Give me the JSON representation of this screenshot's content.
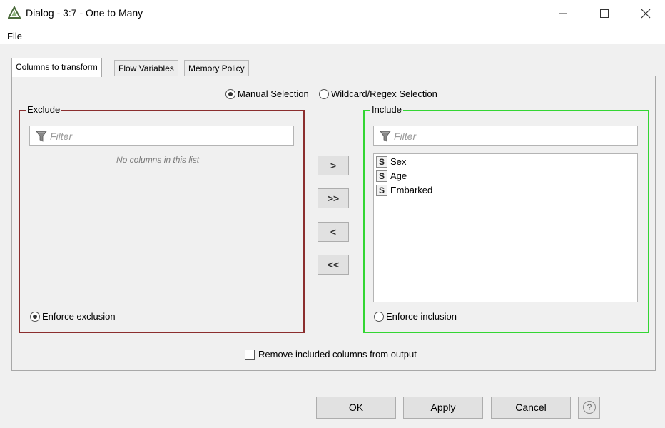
{
  "window": {
    "title": "Dialog - 3:7 - One to Many",
    "app_icon": "knime-triangle-icon",
    "controls": [
      "minimize-icon",
      "maximize-icon",
      "close-icon"
    ]
  },
  "menu": {
    "file": "File"
  },
  "tabs": [
    {
      "label": "Columns to transform",
      "active": true
    },
    {
      "label": "Flow Variables",
      "active": false
    },
    {
      "label": "Memory Policy",
      "active": false
    }
  ],
  "selection_mode": {
    "manual": {
      "label": "Manual Selection",
      "checked": true
    },
    "wildcard": {
      "label": "Wildcard/Regex Selection",
      "checked": false
    }
  },
  "exclude": {
    "legend": "Exclude",
    "border_color": "#8b2e2e",
    "filter_placeholder": "Filter",
    "empty_message": "No columns in this list",
    "enforce_label": "Enforce exclusion",
    "enforce_checked": true
  },
  "include": {
    "legend": "Include",
    "border_color": "#33d633",
    "filter_placeholder": "Filter",
    "items": [
      {
        "type": "S",
        "label": "Sex"
      },
      {
        "type": "S",
        "label": "Age"
      },
      {
        "type": "S",
        "label": "Embarked"
      }
    ],
    "enforce_label": "Enforce inclusion",
    "enforce_checked": false
  },
  "transfer_buttons": {
    "add": ">",
    "add_all": ">>",
    "remove": "<",
    "remove_all": "<<"
  },
  "remove_included": {
    "label": "Remove included columns from output",
    "checked": false
  },
  "buttons": {
    "ok": "OK",
    "apply": "Apply",
    "cancel": "Cancel",
    "help": "?"
  }
}
